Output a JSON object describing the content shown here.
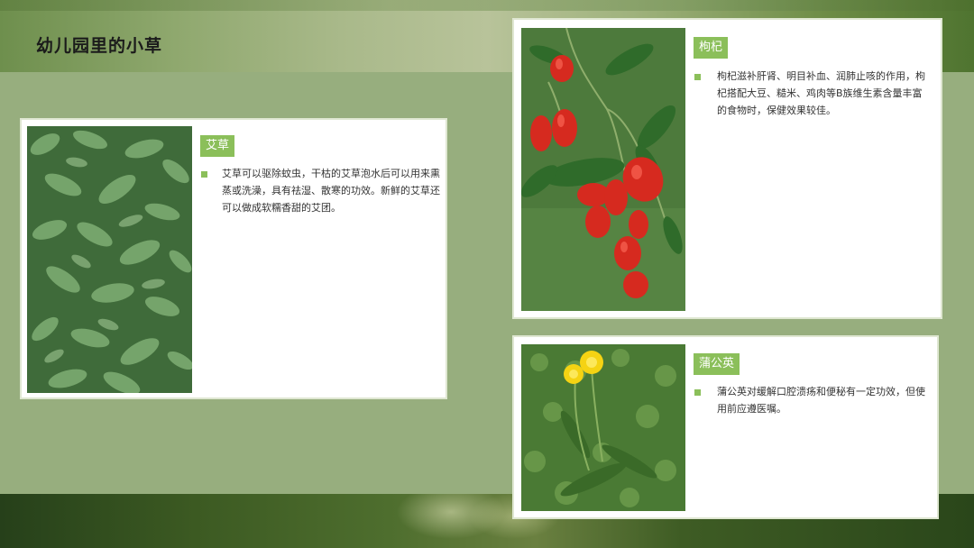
{
  "page": {
    "title": "幼儿园里的小草"
  },
  "plants": [
    {
      "name": "艾草",
      "description": "艾草可以驱除蚊虫，干枯的艾草泡水后可以用来熏蒸或洗澡，具有祛湿、散寒的功效。新鲜的艾草还可以做成软糯香甜的艾团。",
      "image": "mugwort-leaves-photo"
    },
    {
      "name": "枸杞",
      "description": "枸杞滋补肝肾、明目补血、润肺止咳的作用，枸杞搭配大豆、糙米、鸡肉等B族维生素含量丰富的食物时，保健效果较佳。",
      "image": "goji-berries-photo"
    },
    {
      "name": "蒲公英",
      "description": "蒲公英对缓解口腔溃疡和便秘有一定功效，但使用前应遵医嘱。",
      "image": "dandelion-photo"
    }
  ],
  "colors": {
    "accent": "#8bbf5a",
    "background": "#97ae7e",
    "card": "#ffffff"
  }
}
